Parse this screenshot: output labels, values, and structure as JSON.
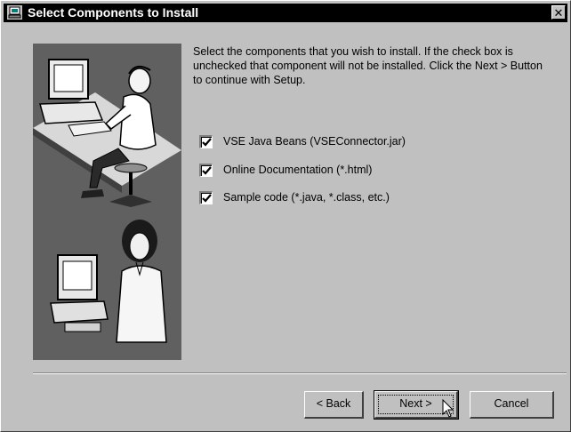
{
  "window": {
    "title": "Select Components to Install",
    "close_symbol": "✕"
  },
  "instructions": "Select the components that you wish to install.  If the check box is unchecked that component will not be installed.  Click the Next > Button to continue with Setup.",
  "components": [
    {
      "label": "VSE Java Beans (VSEConnector.jar)",
      "checked": true
    },
    {
      "label": "Online Documentation (*.html)",
      "checked": true
    },
    {
      "label": "Sample code (*.java, *.class, etc.)",
      "checked": true
    }
  ],
  "buttons": {
    "back": "< Back",
    "next": "Next >",
    "cancel": "Cancel"
  },
  "icons": {
    "title": "installer-app-icon",
    "close": "close-icon",
    "check": "checkmark-icon",
    "cursor": "mouse-pointer-icon"
  },
  "colors": {
    "title_bar": "#000000",
    "dialog_face": "#c0c0c0",
    "illustration_bg": "#606060"
  }
}
